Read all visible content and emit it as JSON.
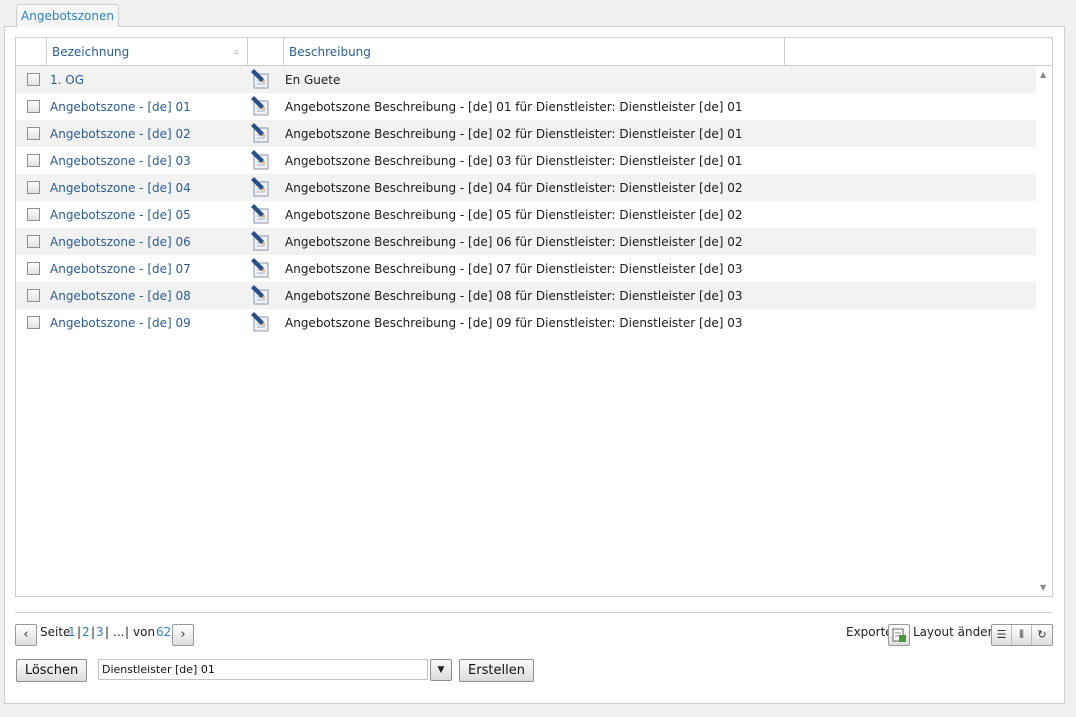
{
  "tab": {
    "label": "Angebotszonen"
  },
  "grid": {
    "columns": {
      "bezeichnung": "Bezeichnung",
      "beschreibung": "Beschreibung"
    },
    "rows": [
      {
        "name": "1. OG",
        "description": "En Guete"
      },
      {
        "name": "Angebotszone - [de] 01",
        "description": "Angebotszone Beschreibung - [de] 01 für Dienstleister: Dienstleister [de] 01"
      },
      {
        "name": "Angebotszone - [de] 02",
        "description": "Angebotszone Beschreibung - [de] 02 für Dienstleister: Dienstleister [de] 01"
      },
      {
        "name": "Angebotszone - [de] 03",
        "description": "Angebotszone Beschreibung - [de] 03 für Dienstleister: Dienstleister [de] 01"
      },
      {
        "name": "Angebotszone - [de] 04",
        "description": "Angebotszone Beschreibung - [de] 04 für Dienstleister: Dienstleister [de] 02"
      },
      {
        "name": "Angebotszone - [de] 05",
        "description": "Angebotszone Beschreibung - [de] 05 für Dienstleister: Dienstleister [de] 02"
      },
      {
        "name": "Angebotszone - [de] 06",
        "description": "Angebotszone Beschreibung - [de] 06 für Dienstleister: Dienstleister [de] 02"
      },
      {
        "name": "Angebotszone - [de] 07",
        "description": "Angebotszone Beschreibung - [de] 07 für Dienstleister: Dienstleister [de] 03"
      },
      {
        "name": "Angebotszone - [de] 08",
        "description": "Angebotszone Beschreibung - [de] 08 für Dienstleister: Dienstleister [de] 03"
      },
      {
        "name": "Angebotszone - [de] 09",
        "description": "Angebotszone Beschreibung - [de] 09 für Dienstleister: Dienstleister [de] 03"
      }
    ]
  },
  "pager": {
    "seite_label": "Seite",
    "pages": [
      "1",
      "2",
      "3"
    ],
    "ellipsis": "...",
    "von_label": "von",
    "total": "62"
  },
  "toolbar": {
    "exporte_label": "Exporte",
    "layout_label": "Layout ändern",
    "delete_label": "Löschen",
    "provider_value": "Dienstleister [de] 01",
    "create_label": "Erstellen"
  },
  "icons": {
    "edit": "pencil-document-icon",
    "export": "export-spreadsheet-icon",
    "list_layout": "list-layout-icon",
    "column_layout": "columns-layout-icon",
    "refresh": "refresh-icon"
  },
  "colors": {
    "link": "#2a5d95",
    "tab_text": "#2b82c9",
    "row_alt": "#f2f2f2"
  }
}
